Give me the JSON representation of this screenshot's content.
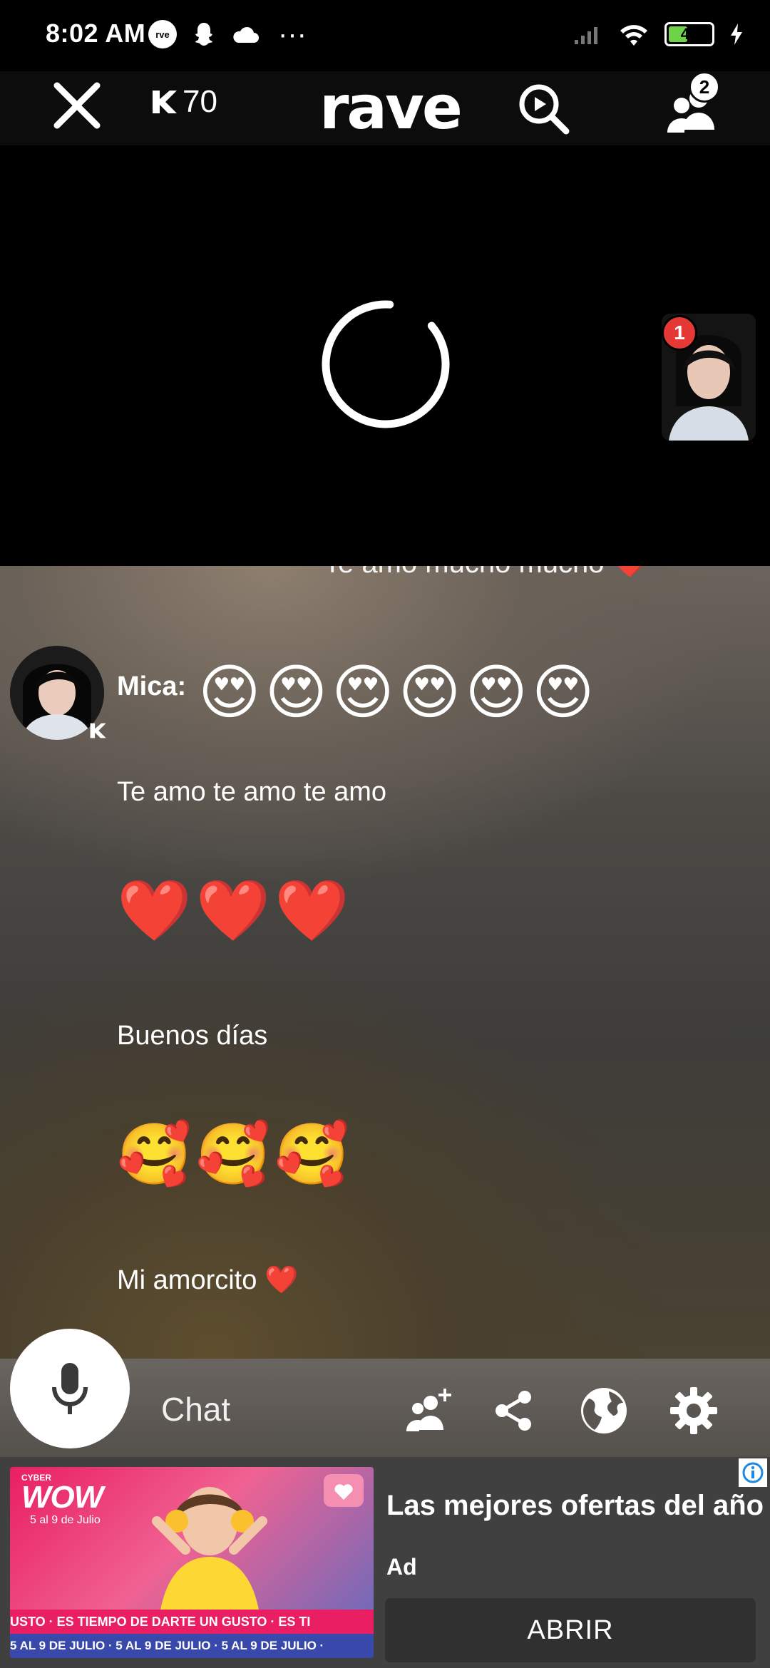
{
  "status_bar": {
    "time": "8:02 AM",
    "battery": "43",
    "icons": [
      "rave-app-icon",
      "snapchat-icon",
      "cloud-icon",
      "more-dots-icon",
      "signal-icon",
      "wifi-icon",
      "battery-icon",
      "charging-icon"
    ]
  },
  "toolbar": {
    "coins": "70",
    "logo": "rave",
    "participants_badge": "2",
    "icons": [
      "close-icon",
      "coin-icon",
      "video-search-icon",
      "participants-icon"
    ]
  },
  "video": {
    "pip_badge": "1",
    "loading": true
  },
  "chat": {
    "partial_message": "Te amo mucho mucho",
    "sender": "Mica:",
    "first_emojis": [
      "😍",
      "😍",
      "😍",
      "😍",
      "😍",
      "😍"
    ],
    "message_1": "Te amo te amo te amo",
    "hearts": [
      "❤️",
      "❤️",
      "❤️"
    ],
    "message_2": "Buenos días",
    "smiles": [
      "🥰",
      "🥰",
      "🥰"
    ],
    "message_3": "Mi amorcito"
  },
  "chat_bar": {
    "label": "Chat",
    "icons": [
      "microphone-icon",
      "add-friend-icon",
      "share-icon",
      "globe-icon",
      "settings-icon"
    ]
  },
  "ad": {
    "banner_brand": "WOW",
    "banner_small": "CYBER",
    "banner_dates": "5 al 9 de Julio",
    "ticker_1": "USTO · ES TIEMPO DE DARTE UN GUSTO · ES TI",
    "ticker_2": "5 AL 9 DE JULIO · 5 AL 9 DE JULIO · 5 AL 9 DE JULIO ·",
    "title": "Las mejores ofertas del año",
    "label": "Ad",
    "cta": "ABRIR"
  },
  "colors": {
    "accent_red": "#e53935",
    "battery_green": "#6fd34a",
    "ad_pink": "#e91e63"
  }
}
